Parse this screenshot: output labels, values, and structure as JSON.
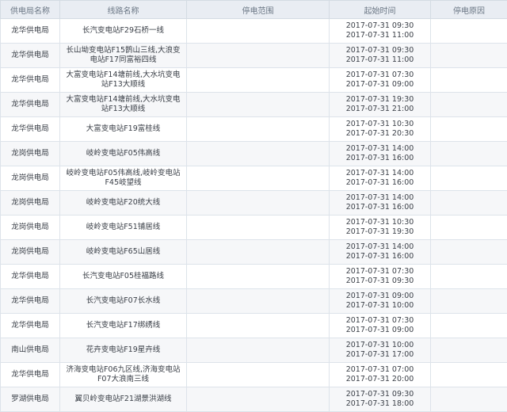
{
  "headers": [
    "供电局名称",
    "线路名称",
    "停电范围",
    "起始时间",
    "停电原因"
  ],
  "rows": [
    {
      "bureau": "龙华供电局",
      "line": "长汽变电站F29石桥一线",
      "scope": "",
      "start": "2017-07-31 09:30",
      "end": "2017-07-31 11:00",
      "reason": ""
    },
    {
      "bureau": "龙华供电局",
      "line": "长山坳变电站F15鹊山三线,大浪变电站F17同富裕四线",
      "scope": "",
      "start": "2017-07-31 09:30",
      "end": "2017-07-31 11:00",
      "reason": ""
    },
    {
      "bureau": "龙华供电局",
      "line": "大富变电站F14塘前线,大水坑变电站F13大顺线",
      "scope": "",
      "start": "2017-07-31 07:30",
      "end": "2017-07-31 09:00",
      "reason": ""
    },
    {
      "bureau": "龙华供电局",
      "line": "大富变电站F14塘前线,大水坑变电站F13大顺线",
      "scope": "",
      "start": "2017-07-31 19:30",
      "end": "2017-07-31 21:00",
      "reason": ""
    },
    {
      "bureau": "龙华供电局",
      "line": "大富变电站F19富桂线",
      "scope": "",
      "start": "2017-07-31 10:30",
      "end": "2017-07-31 20:30",
      "reason": ""
    },
    {
      "bureau": "龙岗供电局",
      "line": "岐岭变电站F05伟高线",
      "scope": "",
      "start": "2017-07-31 14:00",
      "end": "2017-07-31 16:00",
      "reason": ""
    },
    {
      "bureau": "龙岗供电局",
      "line": "岐岭变电站F05伟高线,岐岭变电站F45岐望线",
      "scope": "",
      "start": "2017-07-31 14:00",
      "end": "2017-07-31 16:00",
      "reason": ""
    },
    {
      "bureau": "龙岗供电局",
      "line": "岐岭变电站F20统大线",
      "scope": "",
      "start": "2017-07-31 14:00",
      "end": "2017-07-31 16:00",
      "reason": ""
    },
    {
      "bureau": "龙岗供电局",
      "line": "岐岭变电站F51铺居线",
      "scope": "",
      "start": "2017-07-31 10:30",
      "end": "2017-07-31 19:30",
      "reason": ""
    },
    {
      "bureau": "龙岗供电局",
      "line": "岐岭变电站F65山居线",
      "scope": "",
      "start": "2017-07-31 14:00",
      "end": "2017-07-31 16:00",
      "reason": ""
    },
    {
      "bureau": "龙华供电局",
      "line": "长汽变电站F05桂福路线",
      "scope": "",
      "start": "2017-07-31 07:30",
      "end": "2017-07-31 09:30",
      "reason": ""
    },
    {
      "bureau": "龙华供电局",
      "line": "长汽变电站F07长水线",
      "scope": "",
      "start": "2017-07-31 09:00",
      "end": "2017-07-31 10:00",
      "reason": ""
    },
    {
      "bureau": "龙华供电局",
      "line": "长汽变电站F17绑绣线",
      "scope": "",
      "start": "2017-07-31 07:30",
      "end": "2017-07-31 09:00",
      "reason": ""
    },
    {
      "bureau": "南山供电局",
      "line": "花卉变电站F19星卉线",
      "scope": "",
      "start": "2017-07-31 10:00",
      "end": "2017-07-31 17:00",
      "reason": ""
    },
    {
      "bureau": "龙华供电局",
      "line": "济海变电站F06九区线,济海变电站F07大浪南三线",
      "scope": "",
      "start": "2017-07-31 07:00",
      "end": "2017-07-31 20:00",
      "reason": ""
    },
    {
      "bureau": "罗湖供电局",
      "line": "翼贝岭变电站F21湖景洪湖线",
      "scope": "",
      "start": "2017-07-31 09:30",
      "end": "2017-07-31 18:00",
      "reason": ""
    }
  ]
}
